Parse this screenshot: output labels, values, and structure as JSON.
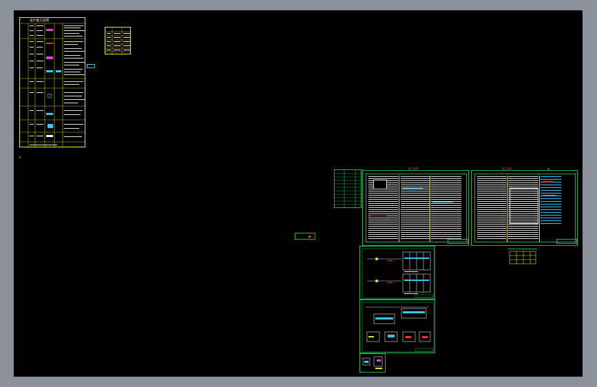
{
  "legend_sheet": {
    "title": "设计施工说明"
  },
  "sheet_titles": {
    "sheet_a": "施工说明",
    "sheet_b": "施工说明"
  },
  "colors": {
    "canvas": "#000000",
    "window_bg": "#8a919b",
    "yellow_frame": "#e8e800",
    "green_frame": "#16b34a",
    "accent_red": "#ff3030",
    "cyan": "#33c8ff",
    "magenta": "#e040e0"
  }
}
